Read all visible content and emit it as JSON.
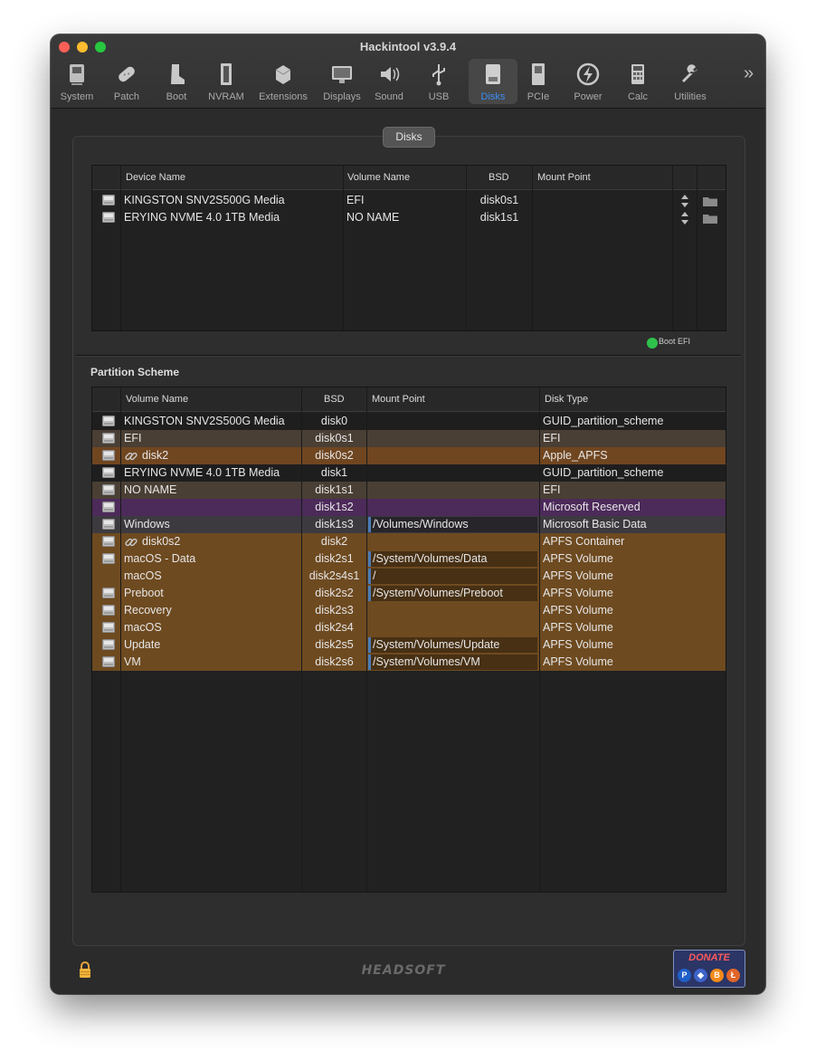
{
  "window": {
    "title": "Hackintool v3.9.4"
  },
  "toolbar": [
    {
      "label": "System",
      "icon": "system-icon"
    },
    {
      "label": "Patch",
      "icon": "patch-icon"
    },
    {
      "label": "Boot",
      "icon": "boot-icon"
    },
    {
      "label": "NVRAM",
      "icon": "nvram-icon"
    },
    {
      "label": "Extensions",
      "icon": "extensions-icon"
    },
    {
      "label": "Displays",
      "icon": "displays-icon"
    },
    {
      "label": "Sound",
      "icon": "sound-icon"
    },
    {
      "label": "USB",
      "icon": "usb-icon"
    },
    {
      "label": "Disks",
      "icon": "disks-icon",
      "active": true
    },
    {
      "label": "PCIe",
      "icon": "pcie-icon"
    },
    {
      "label": "Power",
      "icon": "power-icon"
    },
    {
      "label": "Calc",
      "icon": "calc-icon"
    },
    {
      "label": "Utilities",
      "icon": "utilities-icon"
    }
  ],
  "disks_tab": {
    "label": "Disks"
  },
  "disks_table": {
    "headers": {
      "device": "Device Name",
      "volume": "Volume Name",
      "bsd": "BSD",
      "mount": "Mount Point"
    },
    "rows": [
      {
        "device": "KINGSTON SNV2S500G Media",
        "volume": "EFI",
        "bsd": "disk0s1",
        "mount": ""
      },
      {
        "device": "ERYING NVME 4.0 1TB Media",
        "volume": "NO NAME",
        "bsd": "disk1s1",
        "mount": ""
      }
    ]
  },
  "boot_efi": {
    "label": "Boot EFI",
    "color": "#2fc24b"
  },
  "partition": {
    "title": "Partition Scheme",
    "headers": {
      "volume": "Volume Name",
      "bsd": "BSD",
      "mount": "Mount Point",
      "type": "Disk Type"
    },
    "rows": [
      {
        "volume": "KINGSTON SNV2S500G Media",
        "bsd": "disk0",
        "mount": "",
        "type": "GUID_partition_scheme",
        "color": "#1e1e1e",
        "icon": "disk"
      },
      {
        "volume": "EFI",
        "bsd": "disk0s1",
        "mount": "",
        "type": "EFI",
        "color": "#4a3f34",
        "icon": "disk"
      },
      {
        "volume": "disk2",
        "bsd": "disk0s2",
        "mount": "",
        "type": "Apple_APFS",
        "color": "#704620",
        "icon": "disk",
        "link": true
      },
      {
        "volume": "ERYING NVME 4.0 1TB Media",
        "bsd": "disk1",
        "mount": "",
        "type": "GUID_partition_scheme",
        "color": "#1e1e1e",
        "icon": "disk"
      },
      {
        "volume": "NO NAME",
        "bsd": "disk1s1",
        "mount": "",
        "type": "EFI",
        "color": "#4a3f34",
        "icon": "disk"
      },
      {
        "volume": "",
        "bsd": "disk1s2",
        "mount": "",
        "type": "Microsoft Reserved",
        "color": "#4c2a5a",
        "icon": "disk"
      },
      {
        "volume": "Windows",
        "bsd": "disk1s3",
        "mount": "/Volumes/Windows",
        "type": "Microsoft Basic Data",
        "color": "#3d3a3f",
        "icon": "disk"
      },
      {
        "volume": "disk0s2",
        "bsd": "disk2",
        "mount": "",
        "type": "APFS Container",
        "color": "#6e4a20",
        "icon": "disk",
        "link": true
      },
      {
        "volume": "macOS - Data",
        "bsd": "disk2s1",
        "mount": "/System/Volumes/Data",
        "type": "APFS Volume",
        "color": "#6e4a20",
        "icon": "disk"
      },
      {
        "volume": "macOS",
        "bsd": "disk2s4s1",
        "mount": "/",
        "type": "APFS Volume",
        "color": "#6e4a20",
        "icon": ""
      },
      {
        "volume": "Preboot",
        "bsd": "disk2s2",
        "mount": "/System/Volumes/Preboot",
        "type": "APFS Volume",
        "color": "#6e4a20",
        "icon": "disk"
      },
      {
        "volume": "Recovery",
        "bsd": "disk2s3",
        "mount": "",
        "type": "APFS Volume",
        "color": "#6e4a20",
        "icon": "disk"
      },
      {
        "volume": "macOS",
        "bsd": "disk2s4",
        "mount": "",
        "type": "APFS Volume",
        "color": "#6e4a20",
        "icon": "disk"
      },
      {
        "volume": "Update",
        "bsd": "disk2s5",
        "mount": "/System/Volumes/Update",
        "type": "APFS Volume",
        "color": "#6e4a20",
        "icon": "disk"
      },
      {
        "volume": "VM",
        "bsd": "disk2s6",
        "mount": "/System/Volumes/VM",
        "type": "APFS Volume",
        "color": "#6e4a20",
        "icon": "disk"
      }
    ]
  },
  "footer": {
    "brand": "HEADSOFT",
    "donate": "DONATE"
  }
}
